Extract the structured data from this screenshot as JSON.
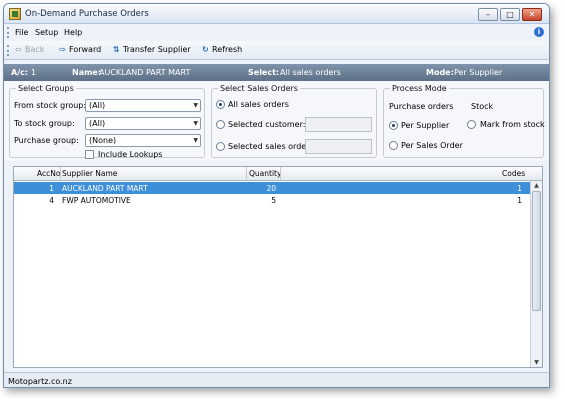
{
  "window": {
    "title": "On-Demand Purchase Orders"
  },
  "menu": {
    "items": [
      "File",
      "Setup",
      "Help"
    ]
  },
  "toolbar": {
    "back": "Back",
    "forward": "Forward",
    "transfer": "Transfer Supplier",
    "refresh": "Refresh"
  },
  "infobar": {
    "ac_label": "A/c:",
    "ac_value": "1",
    "name_label": "Name:",
    "name_value": "AUCKLAND PART MART",
    "select_label": "Select:",
    "select_value": "All sales orders",
    "mode_label": "Mode:",
    "mode_value": "Per Supplier"
  },
  "groups": {
    "legend": "Select Groups",
    "from_label": "From stock group:",
    "from_value": "(All)",
    "to_label": "To stock group:",
    "to_value": "(All)",
    "purchase_label": "Purchase group:",
    "purchase_value": "(None)",
    "lookups_label": "Include Lookups"
  },
  "sales": {
    "legend": "Select Sales Orders",
    "all": "All sales orders",
    "customer": "Selected customer:",
    "order": "Selected sales order:"
  },
  "process": {
    "legend": "Process Mode",
    "po_label": "Purchase orders",
    "stock_label": "Stock",
    "per_supplier": "Per Supplier",
    "mark_from_stock": "Mark from stock",
    "per_sales_order": "Per Sales Order"
  },
  "grid": {
    "headers": {
      "accno": "AccNo",
      "supplier": "Supplier Name",
      "quantity": "Quantity",
      "codes": "Codes"
    },
    "rows": [
      {
        "accno": "1",
        "supplier": "AUCKLAND PART MART",
        "quantity": "20",
        "codes": "1"
      },
      {
        "accno": "4",
        "supplier": "FWP AUTOMOTIVE",
        "quantity": "5",
        "codes": "1"
      }
    ]
  },
  "status": {
    "text": "Motopartz.co.nz"
  },
  "colors": {
    "selection": "#3d8fd9",
    "infobar": "#6b7f96"
  }
}
